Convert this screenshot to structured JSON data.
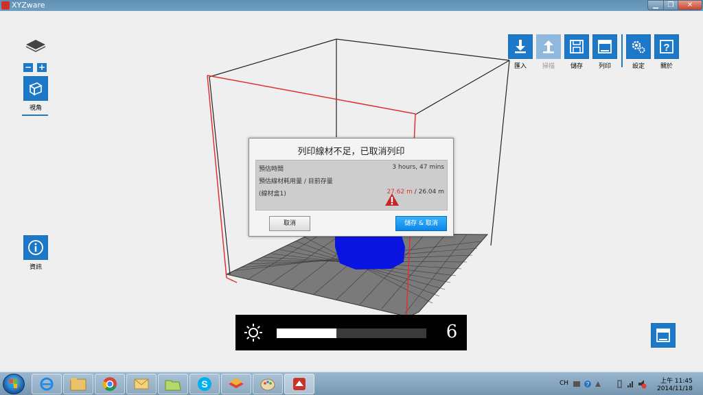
{
  "window": {
    "title": "XYZware"
  },
  "left_toolbar": {
    "zoom_out_label": "−",
    "zoom_in_label": "+",
    "view_label": "視角",
    "info_label": "資訊"
  },
  "top_toolbar": {
    "import_label": "匯入",
    "scan_label": "掃描",
    "save_label": "儲存",
    "print_label": "列印",
    "settings_label": "設定",
    "about_label": "關於"
  },
  "dialog": {
    "title": "列印線材不足，已取消列印",
    "est_time_label": "預估時間",
    "est_time_value": "3 hours, 47 mins",
    "filament_label": "預估線材耗用量 / 目前存量",
    "cartridge_label": "(線材盒1)",
    "filament_needed": "27.62 m",
    "filament_remaining": " / 26.04 m",
    "cancel_label": "取消",
    "save_cancel_label": "儲存 & 取消"
  },
  "brightness_osd": {
    "value": "6",
    "level_fraction": 0.4
  },
  "taskbar": {
    "lang": "CH",
    "time": "上午 11:45",
    "date": "2014/11/18"
  },
  "colors": {
    "accent_blue": "#1e78c8",
    "warning_red": "#e03030",
    "model_blue": "#0a14e0"
  }
}
